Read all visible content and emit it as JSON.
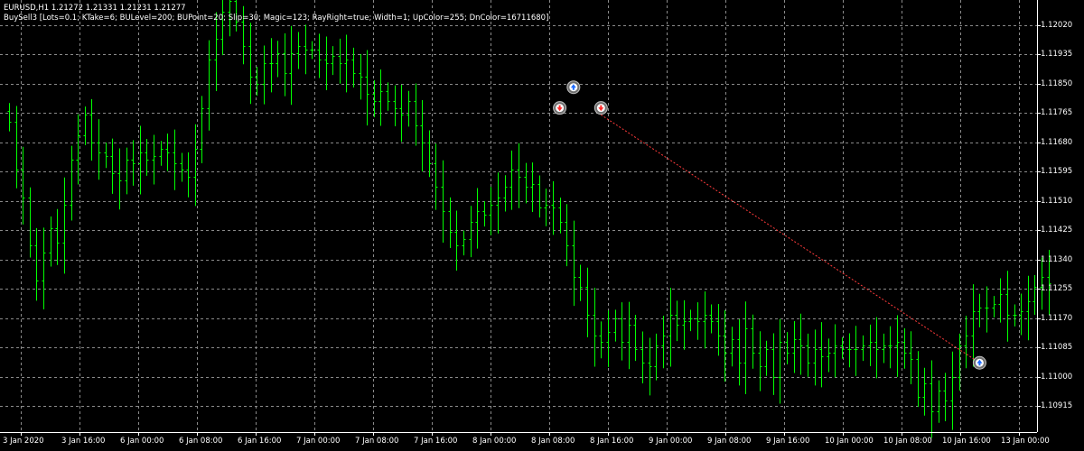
{
  "header": {
    "symbol_info": "EURUSD,H1  1.21272 1.21331 1.21231 1.21277",
    "indicator_info": "BuySell3 [Lots=0.1; KTake=6; BULevel=200; BUPoint=20; Slip=30; Magic=123; RayRight=true; Width=1; UpColor=255; DnColor=16711680]"
  },
  "colors": {
    "background": "#000000",
    "grid": "#8a8a8a",
    "bars": "#00ff00",
    "axis_text": "#ffffff",
    "trade_line": "#ff3b3b",
    "buy_marker": "#1e6cff",
    "sell_marker": "#ff2a2a"
  },
  "chart_data": {
    "type": "ohlc",
    "symbol": "EURUSD",
    "timeframe": "H1",
    "grid": true,
    "ylim": [
      1.1083,
      1.121
    ],
    "y_ticks": [
      "1.12020",
      "1.11935",
      "1.11850",
      "1.11765",
      "1.11680",
      "1.11595",
      "1.11510",
      "1.11425",
      "1.11340",
      "1.11255",
      "1.11170",
      "1.11085",
      "1.11000",
      "1.10915"
    ],
    "y_tick_values": [
      1.1202,
      1.11935,
      1.1185,
      1.11765,
      1.1168,
      1.11595,
      1.1151,
      1.11425,
      1.1134,
      1.11255,
      1.1117,
      1.11085,
      1.11,
      1.10915
    ],
    "x_ticks": [
      "3 Jan 2020",
      "3 Jan 16:00",
      "6 Jan 00:00",
      "6 Jan 08:00",
      "6 Jan 16:00",
      "7 Jan 00:00",
      "7 Jan 08:00",
      "7 Jan 16:00",
      "8 Jan 00:00",
      "8 Jan 08:00",
      "8 Jan 16:00",
      "9 Jan 00:00",
      "9 Jan 08:00",
      "9 Jan 16:00",
      "10 Jan 00:00",
      "10 Jan 08:00",
      "10 Jan 16:00",
      "13 Jan 00:00"
    ],
    "closes": [
      1.1174,
      1.116,
      1.1152,
      1.1138,
      1.1128,
      1.1136,
      1.1143,
      1.1139,
      1.115,
      1.1163,
      1.117,
      1.1176,
      1.1168,
      1.1165,
      1.1164,
      1.1159,
      1.1157,
      1.1163,
      1.1162,
      1.1165,
      1.1163,
      1.1164,
      1.1166,
      1.1165,
      1.1162,
      1.116,
      1.1158,
      1.1166,
      1.1178,
      1.1192,
      1.1198,
      1.1206,
      1.1209,
      1.1203,
      1.1196,
      1.1187,
      1.1185,
      1.1191,
      1.1191,
      1.1194,
      1.1188,
      1.1194,
      1.1196,
      1.1195,
      1.1195,
      1.1192,
      1.1191,
      1.1193,
      1.1191,
      1.1192,
      1.1188,
      1.1187,
      1.1182,
      1.118,
      1.1183,
      1.118,
      1.1178,
      1.1176,
      1.118,
      1.1173,
      1.1168,
      1.1162,
      1.1155,
      1.1148,
      1.1142,
      1.1138,
      1.114,
      1.1145,
      1.1148,
      1.1147,
      1.115,
      1.1152,
      1.1155,
      1.116,
      1.1158,
      1.1155,
      1.1156,
      1.1149,
      1.115,
      1.1149,
      1.1145,
      1.1138,
      1.1129,
      1.1126,
      1.1118,
      1.1112,
      1.111,
      1.1113,
      1.1117,
      1.111,
      1.1115,
      1.1108,
      1.1104,
      1.1103,
      1.1109,
      1.1112,
      1.1118,
      1.1115,
      1.1116,
      1.1117,
      1.1116,
      1.1118,
      1.1116,
      1.1112,
      1.1107,
      1.1111,
      1.1104,
      1.1114,
      1.1107,
      1.1103,
      1.1108,
      1.11,
      1.111,
      1.1107,
      1.1111,
      1.1109,
      1.1104,
      1.1108,
      1.1106,
      1.1107,
      1.1109,
      1.1108,
      1.1108,
      1.1108,
      1.1109,
      1.111,
      1.1108,
      1.1109,
      1.1109,
      1.111,
      1.1107,
      1.1105,
      1.1094,
      1.1098,
      1.109,
      1.1096,
      1.1093,
      1.11,
      1.1109,
      1.1112,
      1.1119,
      1.112,
      1.112,
      1.1121,
      1.1124,
      1.1118,
      1.1118,
      1.1119,
      1.1122,
      1.1126,
      1.1129,
      1.1127
    ],
    "trades": [
      {
        "kind": "buy",
        "index": 82,
        "price": 1.1184
      },
      {
        "kind": "sell",
        "index": 80,
        "price": 1.1178
      },
      {
        "kind": "sell",
        "index": 86,
        "price": 1.1178
      },
      {
        "kind": "buy",
        "index": 141,
        "price": 1.1104
      }
    ],
    "trade_line": {
      "from_index": 86,
      "from_price": 1.1176,
      "to_index": 141,
      "to_price": 1.1104
    }
  }
}
